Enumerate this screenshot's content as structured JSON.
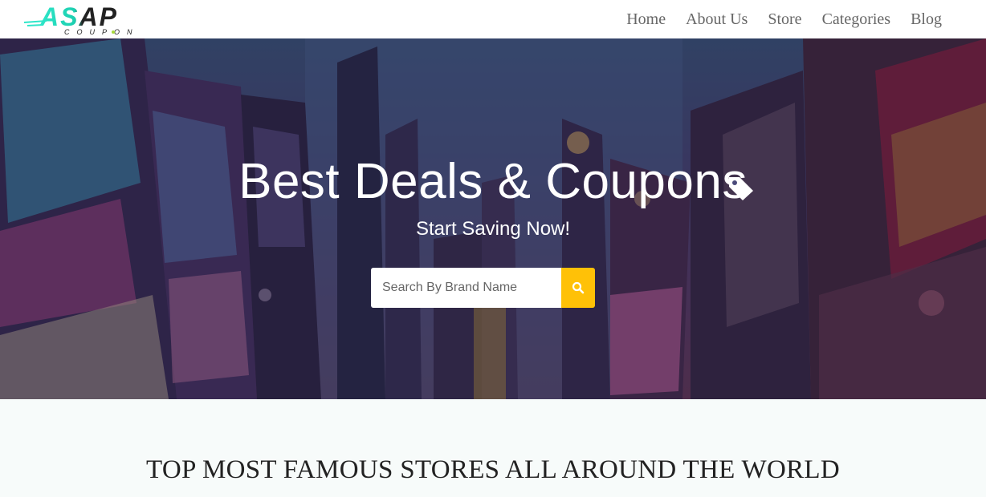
{
  "brand": {
    "logo_text": "ASAP",
    "logo_subtext": "COUPON"
  },
  "nav": {
    "items": [
      {
        "label": "Home"
      },
      {
        "label": "About Us"
      },
      {
        "label": "Store"
      },
      {
        "label": "Categories"
      },
      {
        "label": "Blog"
      }
    ]
  },
  "hero": {
    "title": "Best Deals & Coupons",
    "subtitle": "Start Saving Now!",
    "search": {
      "placeholder": "Search By Brand Name",
      "value": ""
    }
  },
  "section": {
    "title": "TOP MOST FAMOUS STORES ALL AROUND THE WORLD"
  },
  "colors": {
    "accent": "#ffc107",
    "logo_gradient_start": "#2ee6c9",
    "logo_gradient_end": "#222222",
    "nav_text": "#666666"
  },
  "icons": {
    "search": "search-icon",
    "tag": "tag-icon"
  }
}
